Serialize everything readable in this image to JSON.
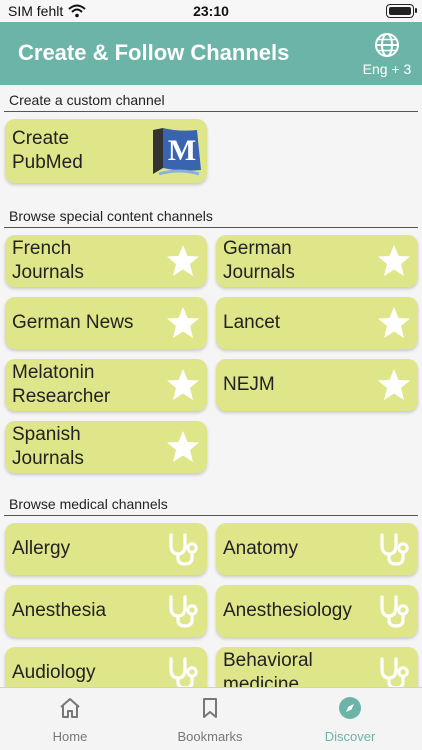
{
  "status": {
    "carrier": "SIM fehlt",
    "time": "23:10"
  },
  "header": {
    "title": "Create & Follow Channels",
    "language": "Eng + 3"
  },
  "sections": {
    "custom": "Create a custom channel",
    "special": "Browse special content channels",
    "medical": "Browse medical channels"
  },
  "custom_tiles": [
    {
      "label": "Create\nPubMed",
      "icon": "pubmed-logo"
    }
  ],
  "special_tiles": [
    {
      "label": "French\nJournals",
      "icon": "star-icon"
    },
    {
      "label": "German\nJournals",
      "icon": "star-icon"
    },
    {
      "label": "German News",
      "icon": "star-icon"
    },
    {
      "label": "Lancet",
      "icon": "star-icon"
    },
    {
      "label": "Melatonin\nResearcher",
      "icon": "star-icon"
    },
    {
      "label": "NEJM",
      "icon": "star-icon"
    },
    {
      "label": "Spanish\nJournals",
      "icon": "star-icon"
    }
  ],
  "medical_tiles": [
    {
      "label": "Allergy",
      "icon": "stethoscope-icon"
    },
    {
      "label": "Anatomy",
      "icon": "stethoscope-icon"
    },
    {
      "label": "Anesthesia",
      "icon": "stethoscope-icon"
    },
    {
      "label": "Anesthesiology",
      "icon": "stethoscope-icon"
    },
    {
      "label": "Audiology",
      "icon": "stethoscope-icon"
    },
    {
      "label": "Behavioral\nmedicine",
      "icon": "stethoscope-icon"
    }
  ],
  "tabs": [
    {
      "label": "Home",
      "icon": "home-icon",
      "active": false
    },
    {
      "label": "Bookmarks",
      "icon": "bookmark-icon",
      "active": false
    },
    {
      "label": "Discover",
      "icon": "compass-icon",
      "active": true
    }
  ],
  "colors": {
    "header": "#6db4a8",
    "tile": "#dfe68a",
    "accent": "#6db4a8"
  }
}
